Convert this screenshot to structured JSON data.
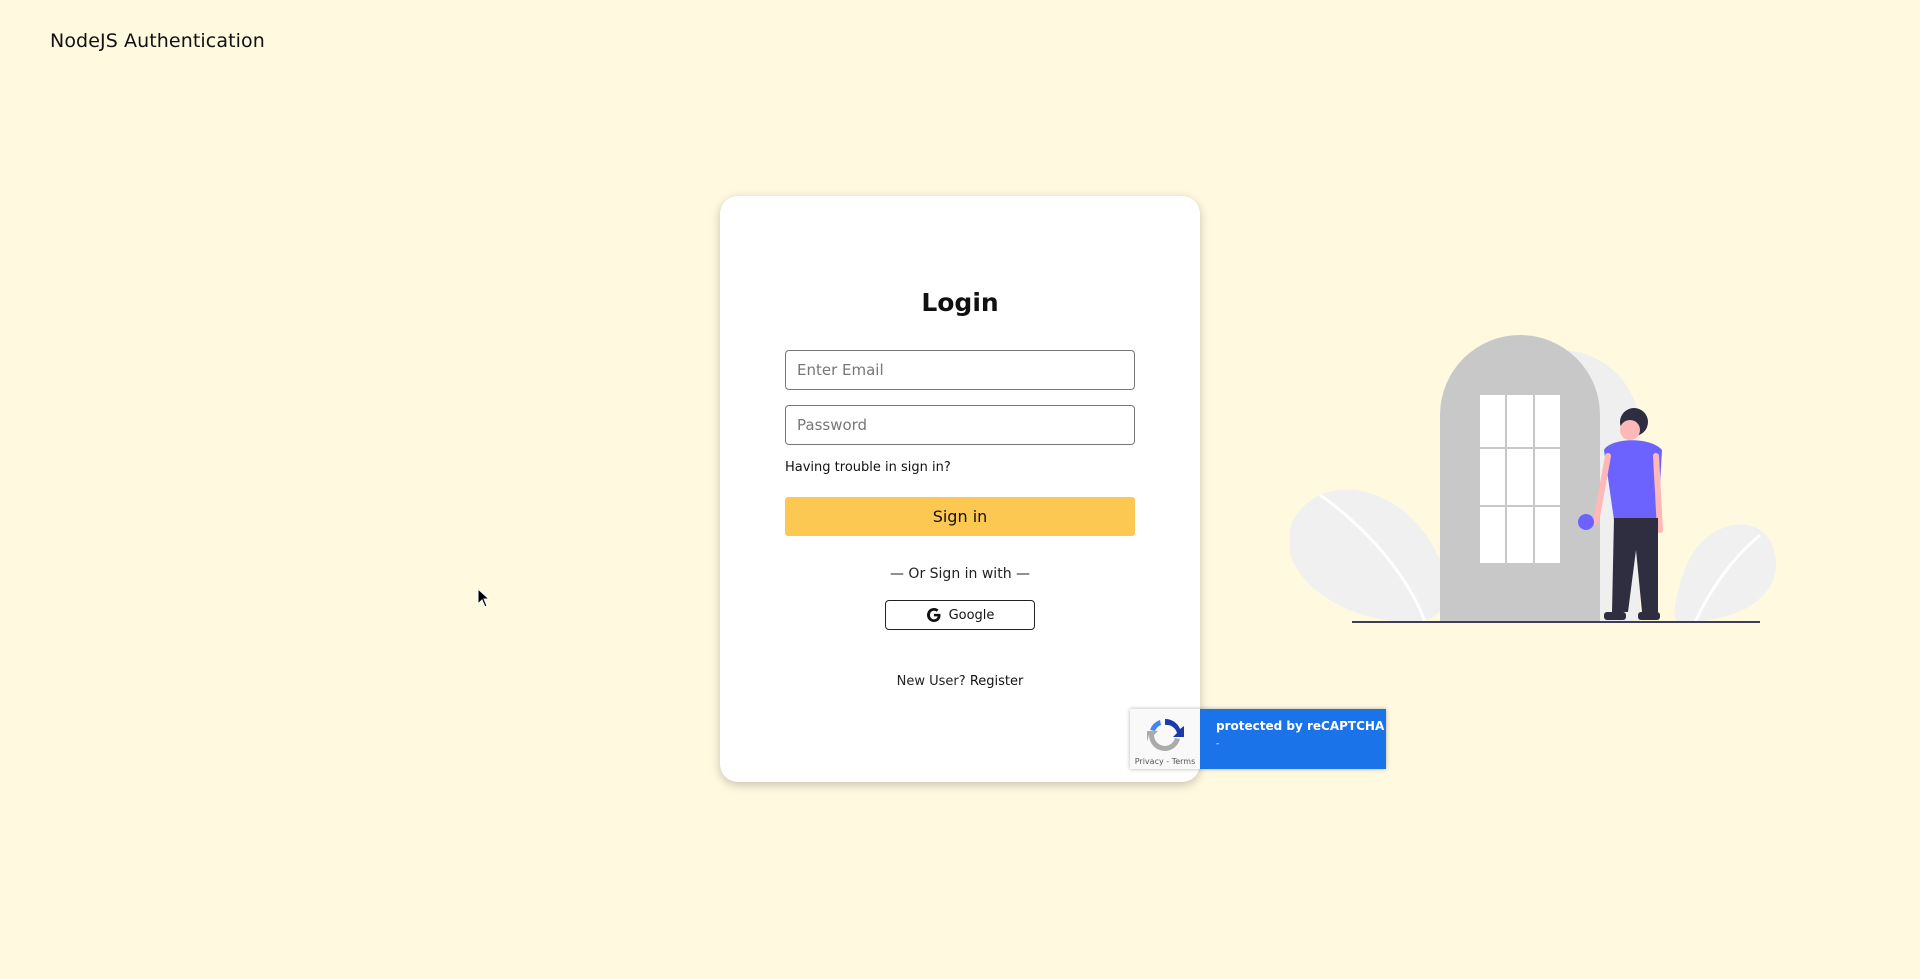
{
  "brand": {
    "title": "NodeJS Authentication"
  },
  "login": {
    "title": "Login",
    "email_placeholder": "Enter Email",
    "email_value": "",
    "password_placeholder": "Password",
    "password_value": "",
    "trouble_link": "Having trouble in sign in?",
    "signin_button": "Sign in",
    "divider": "— Or Sign in with —",
    "google_button": "Google",
    "new_user_text": "New User?",
    "register_link": "Register"
  },
  "recaptcha": {
    "title": "protected by reCAPTCHA",
    "sub": "-",
    "privacy": "Privacy",
    "separator": " - ",
    "terms": "Terms"
  },
  "colors": {
    "background": "#fff9e0",
    "accent": "#fdc851",
    "recaptcha_blue": "#1a73e8",
    "figure_shirt": "#6c63ff"
  },
  "icons": {
    "google": "google-g-icon",
    "recaptcha": "recaptcha-logo-icon",
    "cursor": "mouse-cursor-icon"
  }
}
